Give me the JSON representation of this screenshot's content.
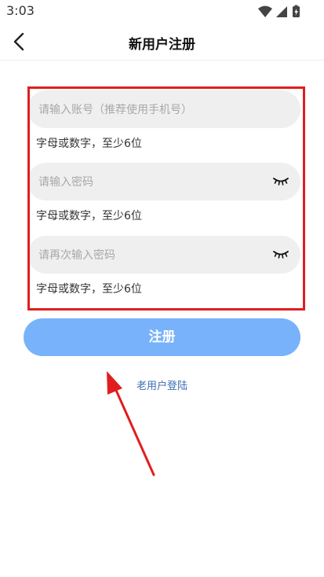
{
  "status": {
    "time": "3:03"
  },
  "header": {
    "title": "新用户注册"
  },
  "form": {
    "account_placeholder": "请输入账号（推荐使用手机号）",
    "account_hint": "字母或数字，至少6位",
    "password_placeholder": "请输入密码",
    "password_hint": "字母或数字，至少6位",
    "confirm_placeholder": "请再次输入密码",
    "confirm_hint": "字母或数字，至少6位"
  },
  "actions": {
    "register_label": "注册",
    "login_link": "老用户登陆"
  },
  "colors": {
    "accent": "#78b2fb",
    "annotation": "#e01e1e",
    "link": "#3a6fb3"
  },
  "icons": [
    "wifi-icon",
    "signal-icon",
    "battery-icon",
    "back-arrow-icon",
    "eye-closed-icon"
  ]
}
